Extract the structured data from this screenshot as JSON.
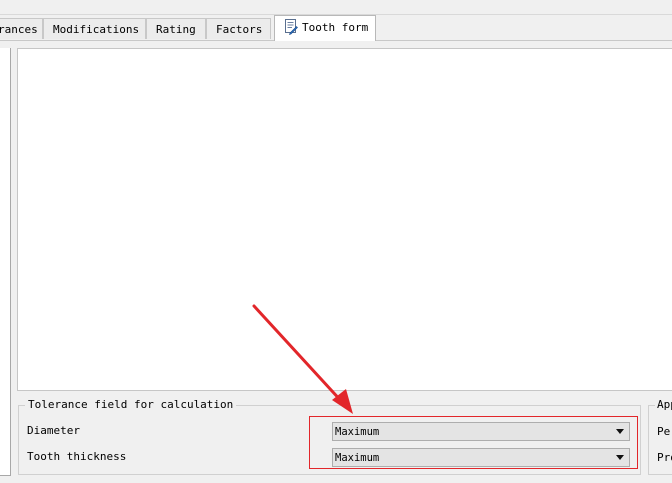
{
  "tabs": [
    {
      "label": "rances",
      "active": false
    },
    {
      "label": "Modifications",
      "active": false
    },
    {
      "label": "Rating",
      "active": false
    },
    {
      "label": "Factors",
      "active": false
    },
    {
      "label": "Tooth form",
      "active": true,
      "icon": "document-edit-icon"
    }
  ],
  "tolerance_group": {
    "title": "Tolerance field for calculation",
    "rows": [
      {
        "label": "Diameter",
        "value": "Maximum"
      },
      {
        "label": "Tooth thickness",
        "value": "Maximum"
      }
    ]
  },
  "side_group": {
    "title": "App",
    "rows": [
      "Per",
      "Pro"
    ]
  },
  "annotation": {
    "color": "#e2262a",
    "shape": "arrow-pointing-to-highlighted-dropdowns"
  }
}
